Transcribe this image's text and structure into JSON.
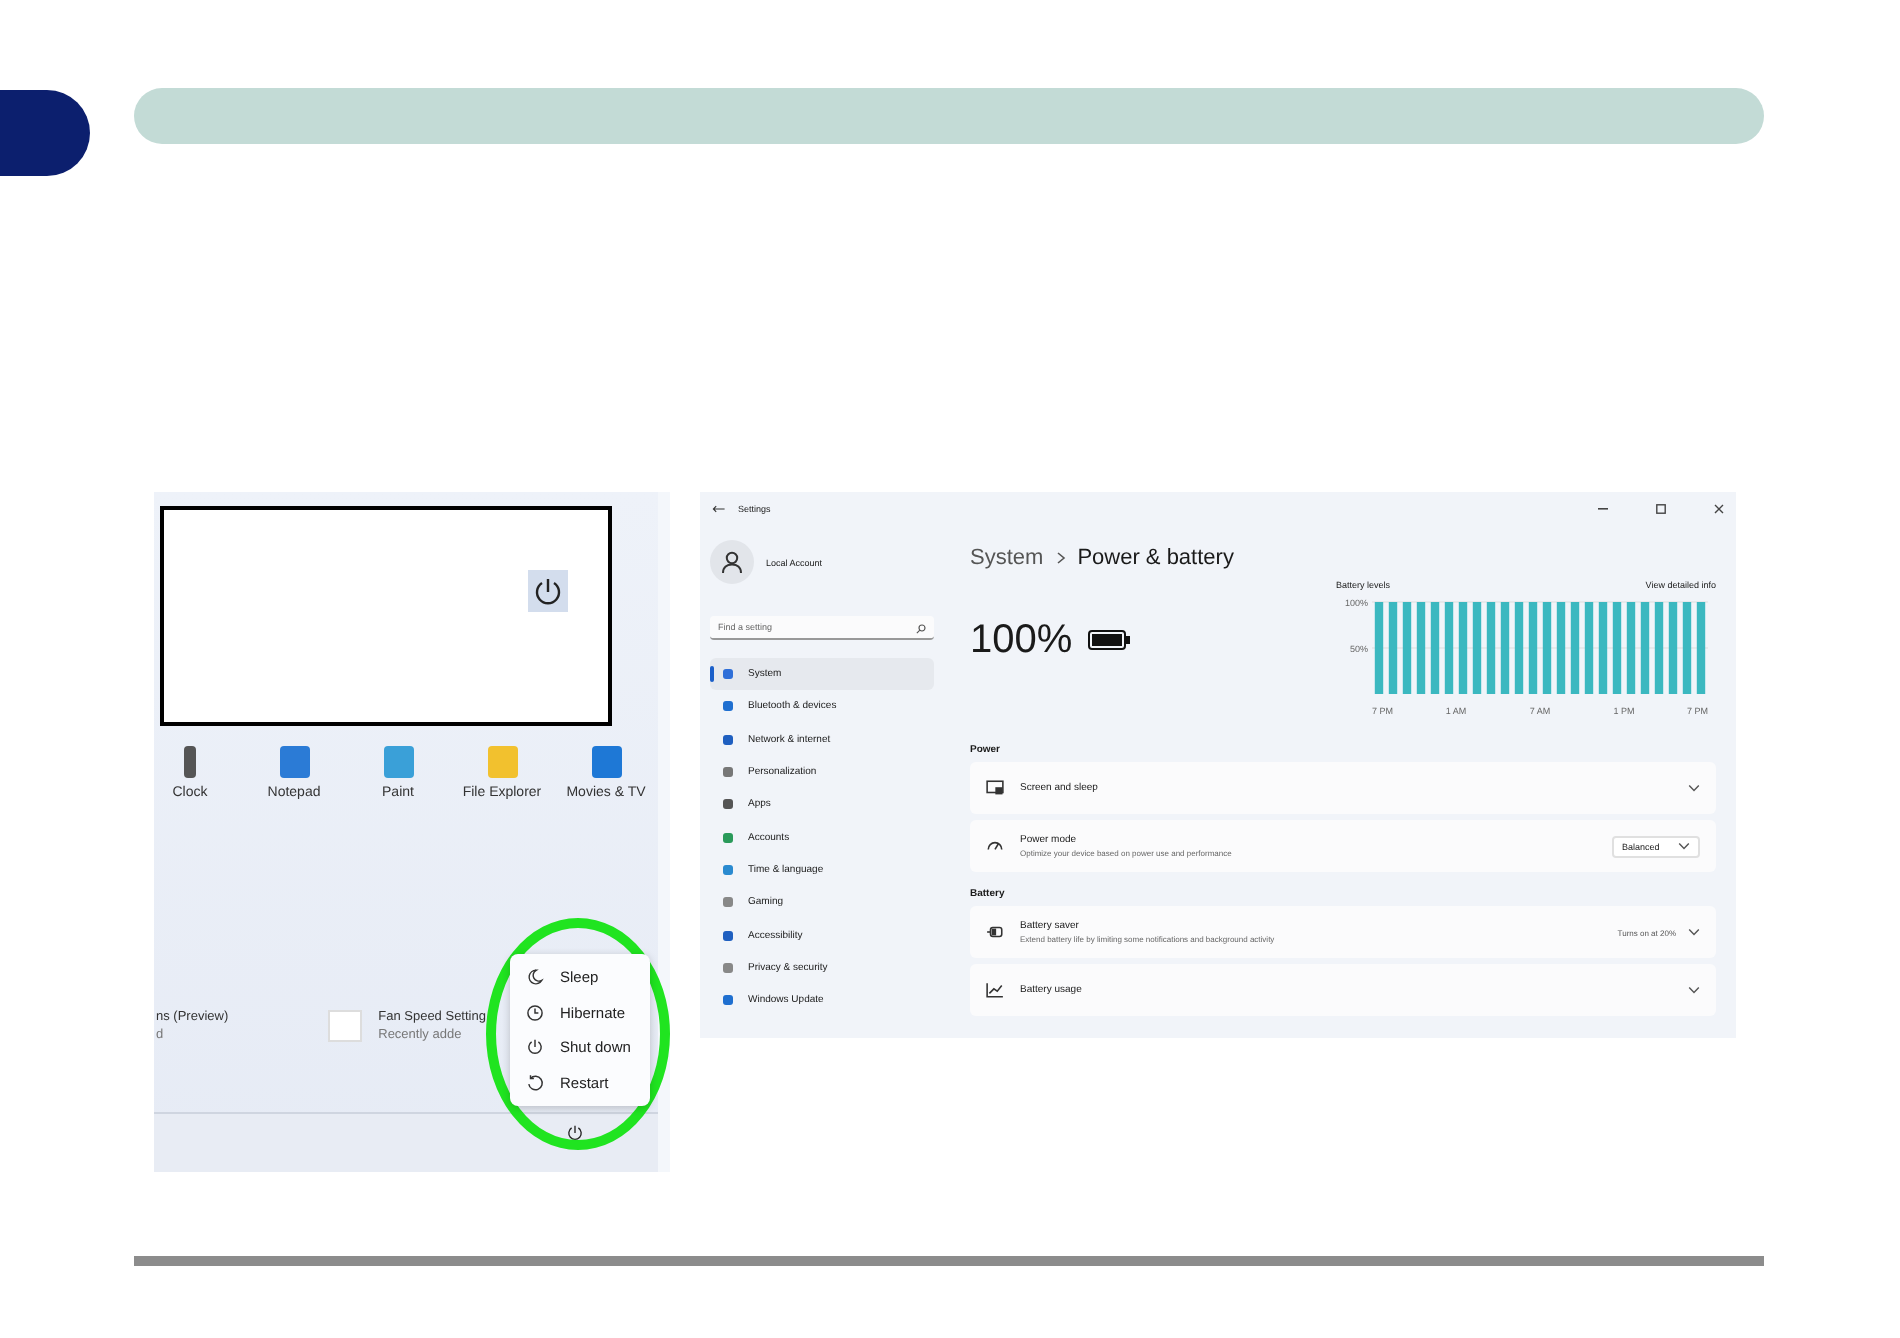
{
  "start_menu": {
    "apps": [
      {
        "label": "Clock"
      },
      {
        "label": "Notepad"
      },
      {
        "label": "Paint"
      },
      {
        "label": "File Explorer"
      },
      {
        "label": "Movies & TV"
      }
    ],
    "recommended": [
      {
        "title": "ns (Preview)",
        "subtitle": "d"
      },
      {
        "title": "Fan Speed Setting",
        "subtitle": "Recently adde"
      }
    ],
    "power_menu": [
      {
        "label": "Sleep",
        "kind": "sleep"
      },
      {
        "label": "Hibernate",
        "kind": "hibernate"
      },
      {
        "label": "Shut down",
        "kind": "shutdown"
      },
      {
        "label": "Restart",
        "kind": "restart"
      }
    ]
  },
  "settings": {
    "window_title": "Settings",
    "account": "Local Account",
    "search": {
      "placeholder": "Find a setting"
    },
    "nav": [
      {
        "label": "System",
        "selected": true
      },
      {
        "label": "Bluetooth & devices",
        "selected": false
      },
      {
        "label": "Network & internet",
        "selected": false
      },
      {
        "label": "Personalization",
        "selected": false
      },
      {
        "label": "Apps",
        "selected": false
      },
      {
        "label": "Accounts",
        "selected": false
      },
      {
        "label": "Time & language",
        "selected": false
      },
      {
        "label": "Gaming",
        "selected": false
      },
      {
        "label": "Accessibility",
        "selected": false
      },
      {
        "label": "Privacy & security",
        "selected": false
      },
      {
        "label": "Windows Update",
        "selected": false
      }
    ],
    "breadcrumb": [
      "System",
      "Power & battery"
    ],
    "battery_percent": "100%",
    "battery_levels": {
      "title": "Battery levels",
      "link": "View detailed info",
      "chart_data": {
        "type": "bar",
        "categories": [
          "7 PM",
          null,
          null,
          null,
          null,
          null,
          "1 AM",
          null,
          null,
          null,
          null,
          null,
          "7 AM",
          null,
          null,
          null,
          null,
          null,
          "1 PM",
          null,
          null,
          null,
          null,
          "7 PM"
        ],
        "values": [
          100,
          100,
          100,
          100,
          100,
          100,
          100,
          100,
          100,
          100,
          100,
          100,
          100,
          100,
          100,
          100,
          100,
          100,
          100,
          100,
          100,
          100,
          100,
          100
        ],
        "ylim": [
          0,
          100
        ],
        "yticks": [
          {
            "value": 50,
            "label": "50%"
          },
          {
            "value": 100,
            "label": "100%"
          }
        ]
      }
    },
    "sections": [
      {
        "heading": "Power",
        "rows": [
          {
            "title": "Screen and sleep",
            "kind": "expand"
          },
          {
            "title": "Power mode",
            "description": "Optimize your device based on power use and performance",
            "value": "Balanced",
            "kind": "dropdown"
          }
        ]
      },
      {
        "heading": "Battery",
        "rows": [
          {
            "title": "Battery saver",
            "description": "Extend battery life by limiting some notifications and background activity",
            "value": "Turns on at 20%",
            "kind": "expand"
          },
          {
            "title": "Battery usage",
            "kind": "expand"
          }
        ]
      }
    ]
  }
}
